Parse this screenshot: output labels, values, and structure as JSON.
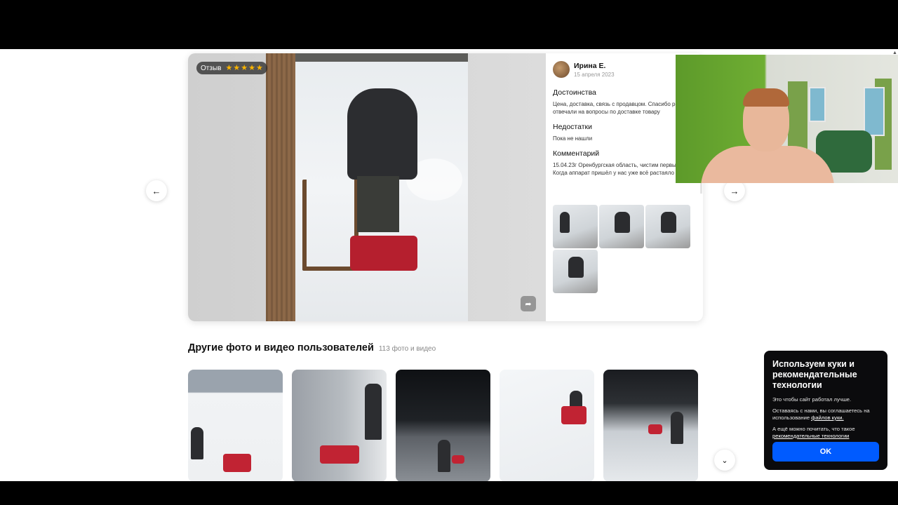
{
  "review": {
    "badge_label": "Отзыв",
    "rating": 5,
    "stars": [
      "★",
      "★",
      "★",
      "★",
      "★"
    ],
    "author_name": "Ирина Е.",
    "date": "15 апреля 2023",
    "pros_title": "Достоинства",
    "pros_text": "Цена, доставка, связь с продавцом. Спасибо ребятам отвечали на вопросы по доставке товару",
    "cons_title": "Недостатки",
    "cons_text": "Пока не нашли",
    "comment_title": "Комментарий",
    "comment_text": "15.04.23г Оренбургская область, чистим первый раз. Когда аппарат пришёл у нас уже всё растаяло",
    "photo_count": 4
  },
  "icons": {
    "prev": "←",
    "next": "→",
    "share": "➦",
    "gallery_more": "⌄"
  },
  "gallery": {
    "heading": "Другие фото и видео пользователей",
    "count": "113 фото и видео"
  },
  "cookie": {
    "title": "Используем куки и рекомендательные технологии",
    "p1": "Это чтобы сайт работал лучше.",
    "p2_prefix": "Оставаясь с нами, вы соглашаетесь на использование ",
    "p2_link": "файлов куки.",
    "p3_prefix": "А ещё можно почитать, что такое ",
    "p3_link": "рекомендательные технологии",
    "ok": "OK"
  },
  "colors": {
    "accent": "#005bff",
    "star": "#f9b400",
    "banner_bg": "#0b0b0d"
  }
}
